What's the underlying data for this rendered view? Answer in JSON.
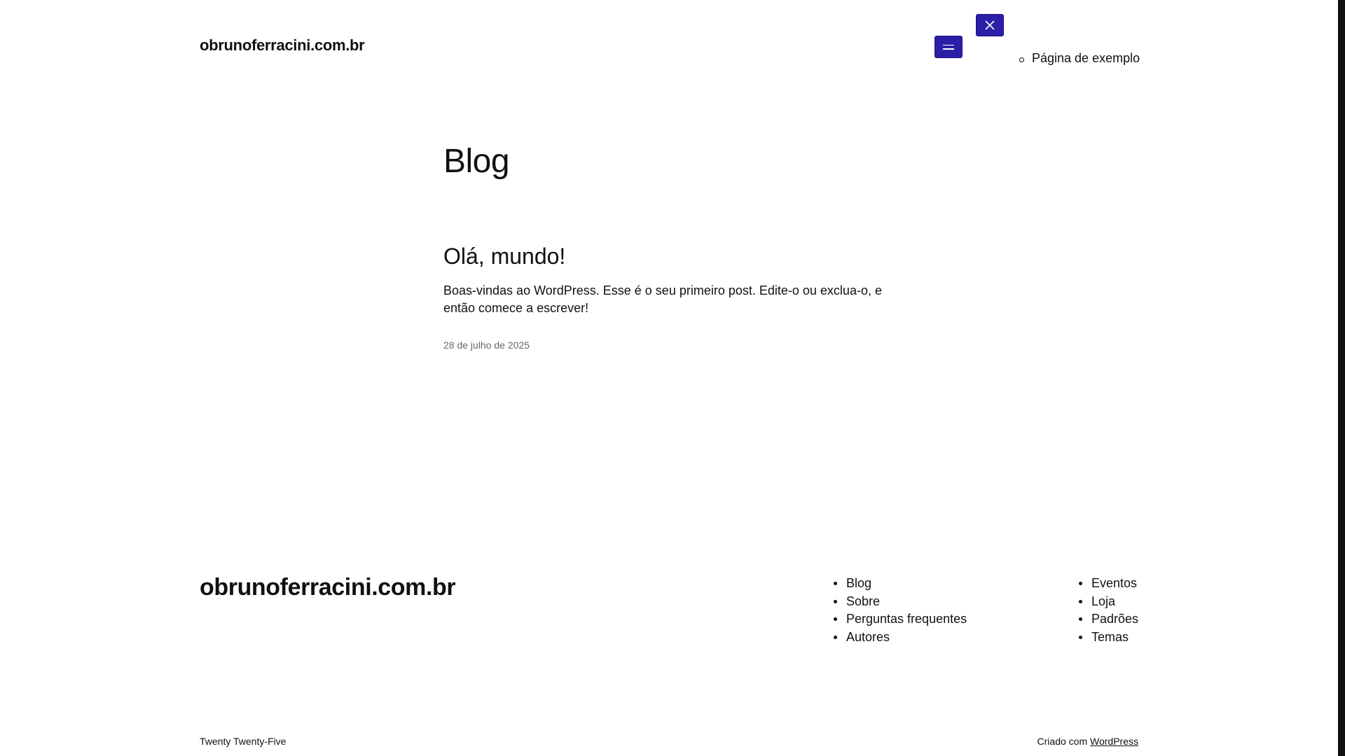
{
  "header": {
    "site_title": "obrunoferracini.com.br",
    "nav_items": [
      {
        "label": "Página de exemplo"
      }
    ],
    "accent_color": "#2b1fa8"
  },
  "main": {
    "page_title": "Blog",
    "post": {
      "title": "Olá, mundo!",
      "excerpt": "Boas-vindas ao WordPress. Esse é o seu primeiro post. Edite-o ou exclua-o, e então comece a escrever!",
      "date": "28 de julho de 2025"
    }
  },
  "footer": {
    "site_title": "obrunoferracini.com.br",
    "nav_column_1": [
      {
        "label": "Blog"
      },
      {
        "label": "Sobre"
      },
      {
        "label": "Perguntas frequentes"
      },
      {
        "label": "Autores"
      }
    ],
    "nav_column_2": [
      {
        "label": "Eventos"
      },
      {
        "label": "Loja"
      },
      {
        "label": "Padrões"
      },
      {
        "label": "Temas"
      }
    ],
    "theme_credit": "Twenty Twenty-Five",
    "made_with_prefix": "Criado com",
    "made_with_link": "WordPress"
  },
  "icons": {
    "menu": "hamburger-menu-icon",
    "close": "close-icon"
  }
}
